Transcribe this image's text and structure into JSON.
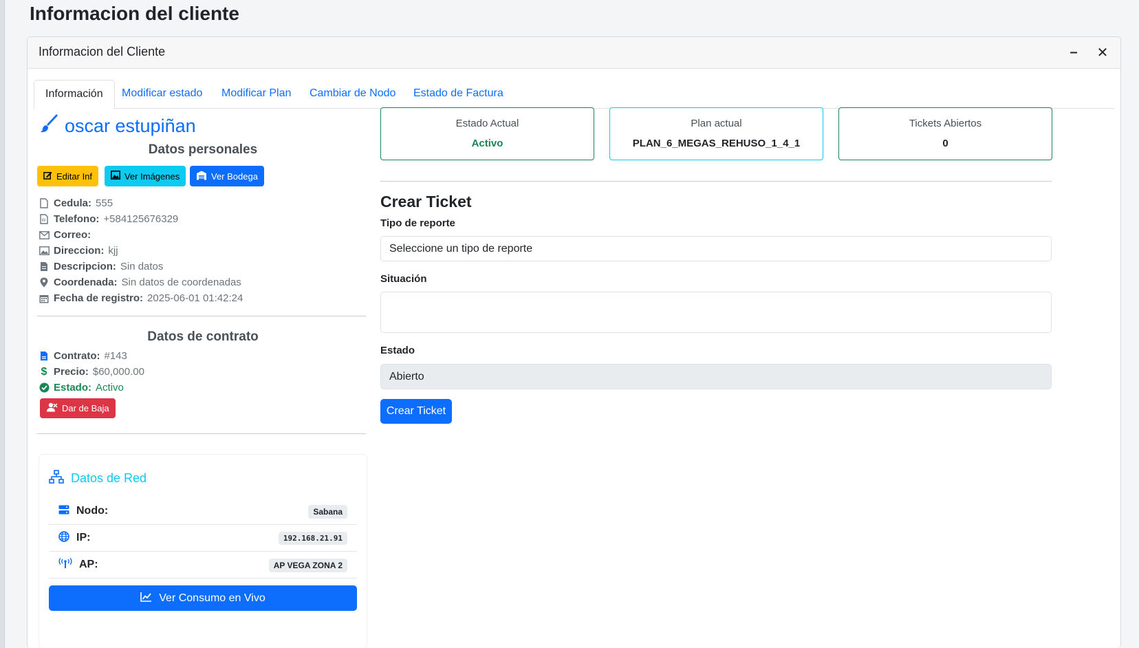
{
  "page": {
    "title": "Informacion del cliente"
  },
  "card": {
    "title": "Informacion del Cliente",
    "minimize_label": "–",
    "close_label": "✕"
  },
  "tabs": [
    {
      "label": "Información",
      "active": true
    },
    {
      "label": "Modificar estado"
    },
    {
      "label": "Modificar Plan"
    },
    {
      "label": "Cambiar de Nodo"
    },
    {
      "label": "Estado de Factura"
    }
  ],
  "client": {
    "name": "oscar estupiñan",
    "personal_heading": "Datos personales",
    "buttons": {
      "edit": "Editar Inf",
      "images": "Ver Imágenes",
      "warehouse": "Ver Bodega"
    },
    "fields": [
      {
        "label": "Cedula:",
        "value": "555",
        "icon": "file-icon"
      },
      {
        "label": "Telefono:",
        "value": "+584125676329",
        "icon": "file-word-icon"
      },
      {
        "label": "Correo:",
        "value": "",
        "icon": "envelope-icon"
      },
      {
        "label": "Direccion:",
        "value": "kjj",
        "icon": "image-icon"
      },
      {
        "label": "Descripcion:",
        "value": "Sin datos",
        "icon": "file-text-icon"
      },
      {
        "label": "Coordenada:",
        "value": "Sin datos de coordenadas",
        "icon": "map-pin-icon"
      },
      {
        "label": "Fecha de registro:",
        "value": "2025-06-01 01:42:24",
        "icon": "calendar-icon"
      }
    ]
  },
  "contract": {
    "heading": "Datos de contrato",
    "number_label": "Contrato:",
    "number": "#143",
    "price_label": "Precio:",
    "price": "$60,000.00",
    "status_label": "Estado:",
    "status": "Activo",
    "cancel_button": "Dar de Baja"
  },
  "network": {
    "title": "Datos de Red",
    "rows": [
      {
        "label": "Nodo:",
        "value": "Sabana",
        "icon": "server-icon"
      },
      {
        "label": "IP:",
        "value": "192.168.21.91",
        "icon": "globe-icon"
      },
      {
        "label": "AP:",
        "value": "AP VEGA ZONA 2",
        "icon": "antenna-icon"
      }
    ],
    "live_button": "Ver Consumo en Vivo"
  },
  "stats": [
    {
      "label": "Estado Actual",
      "value": "Activo"
    },
    {
      "label": "Plan actual",
      "value": "PLAN_6_MEGAS_REHUSO_1_4_1"
    },
    {
      "label": "Tickets Abiertos",
      "value": "0"
    }
  ],
  "ticket": {
    "title": "Crear Ticket",
    "type_label": "Tipo de reporte",
    "type_value": "Seleccione un tipo de reporte",
    "situation_label": "Situación",
    "situation_value": "",
    "state_label": "Estado",
    "state_value": "Abierto",
    "submit": "Crear Ticket"
  },
  "colors": {
    "primary": "#0d6efd",
    "success": "#198754",
    "info": "#0dcaf0",
    "warning": "#ffc107",
    "danger": "#dc3545"
  }
}
